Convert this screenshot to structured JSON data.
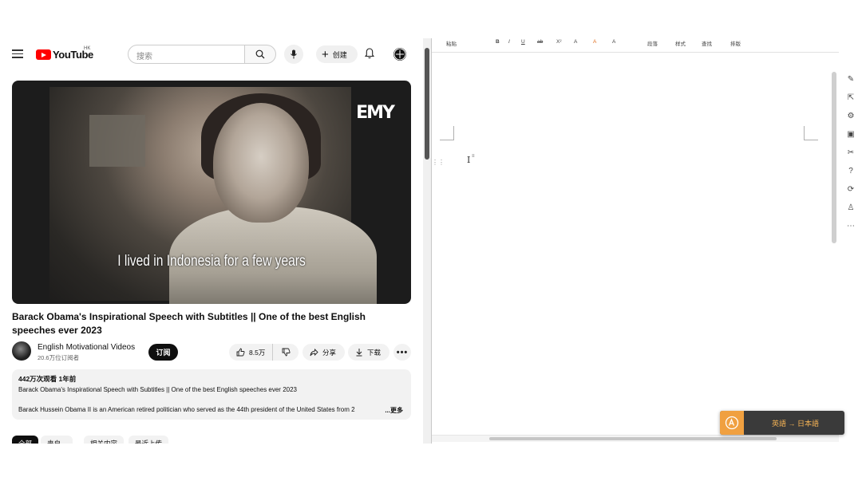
{
  "youtube": {
    "logo_text": "YouTube",
    "region": "HK",
    "search_placeholder": "搜索",
    "create_label": "创建",
    "video": {
      "watermark": "EMY",
      "subtitle": "I lived in Indonesia for a few years"
    },
    "title": "Barack Obama's Inspirational Speech with Subtitles || One of the best English speeches ever 2023",
    "channel": {
      "name": "English Motivational Videos",
      "subscribers": "20.6万位订阅者",
      "subscribe_label": "订阅"
    },
    "actions": {
      "likes": "8.5万",
      "share": "分享",
      "download": "下载",
      "more": "•••"
    },
    "description": {
      "stats": "442万次观看  1年前",
      "line1": "Barack Obama's Inspirational Speech with Subtitles || One of the best English speeches ever 2023",
      "line2": "Barack Hussein Obama II is an American retired politician who served as the 44th president of the United States from 2",
      "more": "...更多"
    },
    "chips": [
      "全部",
      "来自...",
      "相关内容",
      "最近上传"
    ]
  },
  "editor": {
    "ribbon": [
      "粘贴",
      "B",
      "I",
      "U",
      "ab",
      "X²",
      "A",
      "A",
      "A",
      "段落",
      "样式",
      "查找",
      "排版"
    ],
    "cursor_mark": "I",
    "para_mark": "≡"
  },
  "translator": {
    "label": "英語 → 日本語"
  },
  "colors": {
    "youtube_red": "#ff0000",
    "translator_accent": "#f0a040",
    "translator_bg": "#3a3a3a"
  }
}
